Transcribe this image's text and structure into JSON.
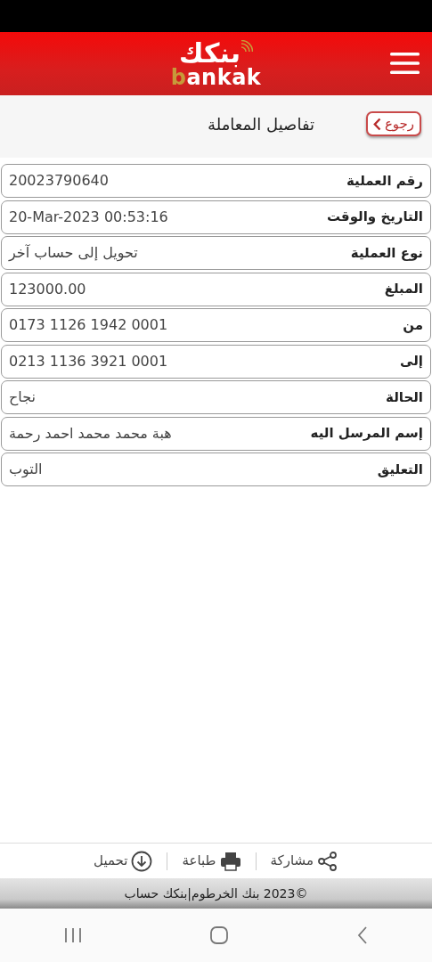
{
  "header": {
    "logo_arabic": "بنكك",
    "logo_latin": "bankak"
  },
  "page": {
    "title": "تفاصيل المعاملة",
    "back_button": "رجوع"
  },
  "details": [
    {
      "label": "رقم العملية",
      "value": "20023790640"
    },
    {
      "label": "التاريخ والوقت",
      "value": "20-Mar-2023 00:53:16"
    },
    {
      "label": "نوع العملية",
      "value": "تحويل إلى حساب آخر"
    },
    {
      "label": "المبلغ",
      "value": "123000.00"
    },
    {
      "label": "من",
      "value": "0173 1126 1942 0001"
    },
    {
      "label": "إلى",
      "value": "0213 1136 3921 0001"
    },
    {
      "label": "الحالة",
      "value": "نجاح"
    },
    {
      "label": "إسم المرسل اليه",
      "value": "هبة محمد محمد احمد رحمة"
    },
    {
      "label": "التعليق",
      "value": "التوب"
    }
  ],
  "actions": [
    {
      "kind": "share",
      "label": "مشاركة"
    },
    {
      "kind": "print",
      "label": "طباعة"
    },
    {
      "kind": "download",
      "label": "تحميل"
    }
  ],
  "footer": "©2023 بنك الخرطوم|بنكك حساب"
}
